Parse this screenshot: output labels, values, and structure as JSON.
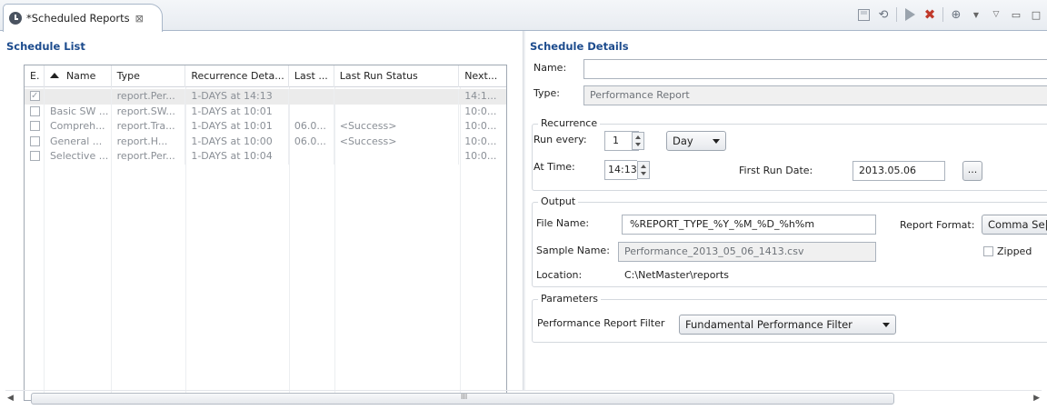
{
  "tab": {
    "title": "*Scheduled Reports",
    "close": "⊠"
  },
  "schedule_list": {
    "title": "Schedule List",
    "columns": [
      "E.",
      "Name",
      "Type",
      "Recurrence Deta...",
      "Last ...",
      "Last Run Status",
      "Next..."
    ],
    "rows": [
      {
        "enabled": true,
        "name": "",
        "type": "report.Per...",
        "recurrence": "1-DAYS at 14:13",
        "last": "",
        "status": "",
        "next": "14:1..."
      },
      {
        "enabled": false,
        "name": "Basic SW ...",
        "type": "report.SW...",
        "recurrence": "1-DAYS at 10:01",
        "last": "",
        "status": "",
        "next": "10:0..."
      },
      {
        "enabled": false,
        "name": "Compreh...",
        "type": "report.Tra...",
        "recurrence": "1-DAYS at 10:01",
        "last": "06.0...",
        "status": "<Success>",
        "next": "10:0..."
      },
      {
        "enabled": false,
        "name": "General ...",
        "type": "report.H...",
        "recurrence": "1-DAYS at 10:00",
        "last": "06.0...",
        "status": "<Success>",
        "next": "10:0..."
      },
      {
        "enabled": false,
        "name": "Selective ...",
        "type": "report.Per...",
        "recurrence": "1-DAYS at 10:04",
        "last": "",
        "status": "",
        "next": "10:0..."
      }
    ]
  },
  "details": {
    "title": "Schedule Details",
    "name_label": "Name:",
    "name_value": "",
    "type_label": "Type:",
    "type_value": "Performance Report",
    "recurrence": {
      "title": "Recurrence",
      "run_every_label": "Run every:",
      "run_every_value": "1",
      "unit": "Day",
      "at_time_label": "At Time:",
      "at_time_value": "14:13",
      "first_run_label": "First Run Date:",
      "first_run_value": "2013.05.06",
      "browse_label": "..."
    },
    "output": {
      "title": "Output",
      "file_name_label": "File Name:",
      "file_name_value": "%REPORT_TYPE_%Y_%M_%D_%h%m",
      "report_format_label": "Report Format:",
      "report_format_value": "Comma Se|",
      "sample_name_label": "Sample Name:",
      "sample_name_value": "Performance_2013_05_06_1413.csv",
      "zipped_label": "Zipped",
      "location_label": "Location:",
      "location_value": "C:\\NetMaster\\reports"
    },
    "parameters": {
      "title": "Parameters",
      "filter_label": "Performance Report Filter",
      "filter_value": "Fundamental Performance Filter"
    }
  },
  "scrollbar": {
    "grip": "III"
  }
}
